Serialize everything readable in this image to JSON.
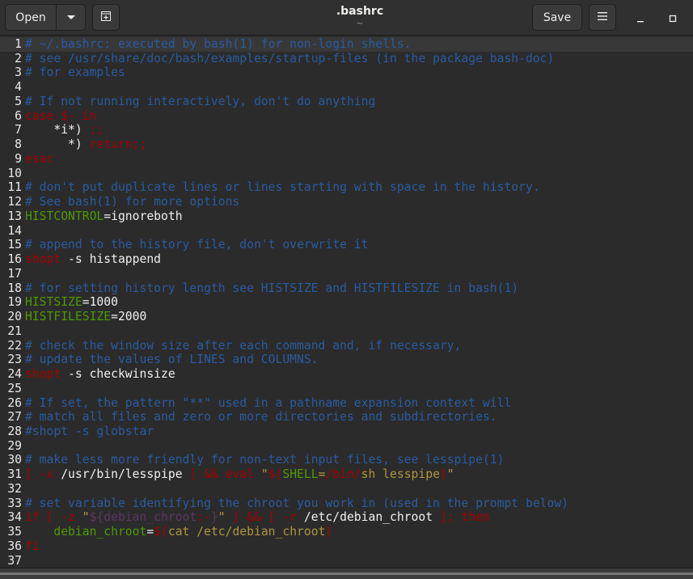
{
  "header": {
    "open_label": "Open",
    "open_menu_icon": "chevron-down-icon",
    "new_tab_icon": "new-document-icon",
    "title": ".bashrc",
    "subtitle": "~",
    "save_label": "Save",
    "menu_icon": "hamburger-icon",
    "minimize_icon": "minimize-icon",
    "maximize_icon": "maximize-icon"
  },
  "colors": {
    "comment": "#2a5ba0",
    "keyword": "#a40000",
    "variable": "#4e9a06",
    "string": "#b09540",
    "plain": "#f0f0f0"
  },
  "editor": {
    "current_line": 1,
    "lines": [
      {
        "n": "1",
        "segs": [
          [
            "comment",
            "# ~/.bashrc: executed by bash(1) for non-login shells."
          ]
        ]
      },
      {
        "n": "2",
        "segs": [
          [
            "comment",
            "# see /usr/share/doc/bash/examples/startup-files (in the package bash-doc)"
          ]
        ]
      },
      {
        "n": "3",
        "segs": [
          [
            "comment",
            "# for examples"
          ]
        ]
      },
      {
        "n": "4",
        "segs": []
      },
      {
        "n": "5",
        "segs": [
          [
            "comment",
            "# If not running interactively, don't do anything"
          ]
        ]
      },
      {
        "n": "6",
        "segs": [
          [
            "kw",
            "case"
          ],
          [
            "plain",
            " "
          ],
          [
            "kw",
            "$-"
          ],
          [
            "plain",
            " "
          ],
          [
            "kw",
            "in"
          ]
        ]
      },
      {
        "n": "7",
        "segs": [
          [
            "plain",
            "    *i*) "
          ],
          [
            "kw",
            ";;"
          ]
        ]
      },
      {
        "n": "8",
        "segs": [
          [
            "plain",
            "      *) "
          ],
          [
            "kw",
            "return;;"
          ]
        ]
      },
      {
        "n": "9",
        "segs": [
          [
            "kw",
            "esac"
          ]
        ]
      },
      {
        "n": "10",
        "segs": []
      },
      {
        "n": "11",
        "segs": [
          [
            "comment",
            "# don't put duplicate lines or lines starting with space in the history."
          ]
        ]
      },
      {
        "n": "12",
        "segs": [
          [
            "comment",
            "# See bash(1) for more options"
          ]
        ]
      },
      {
        "n": "13",
        "segs": [
          [
            "var",
            "HISTCONTROL"
          ],
          [
            "plain",
            "=ignoreboth"
          ]
        ]
      },
      {
        "n": "14",
        "segs": []
      },
      {
        "n": "15",
        "segs": [
          [
            "comment",
            "# append to the history file, don't overwrite it"
          ]
        ]
      },
      {
        "n": "16",
        "segs": [
          [
            "kw",
            "shopt"
          ],
          [
            "plain",
            " -s histappend"
          ]
        ]
      },
      {
        "n": "17",
        "segs": []
      },
      {
        "n": "18",
        "segs": [
          [
            "comment",
            "# for setting history length see HISTSIZE and HISTFILESIZE in bash(1)"
          ]
        ]
      },
      {
        "n": "19",
        "segs": [
          [
            "var",
            "HISTSIZE"
          ],
          [
            "plain",
            "=1000"
          ]
        ]
      },
      {
        "n": "20",
        "segs": [
          [
            "var",
            "HISTFILESIZE"
          ],
          [
            "plain",
            "=2000"
          ]
        ]
      },
      {
        "n": "21",
        "segs": []
      },
      {
        "n": "22",
        "segs": [
          [
            "comment",
            "# check the window size after each command and, if necessary,"
          ]
        ]
      },
      {
        "n": "23",
        "segs": [
          [
            "comment",
            "# update the values of LINES and COLUMNS."
          ]
        ]
      },
      {
        "n": "24",
        "segs": [
          [
            "kw",
            "shopt"
          ],
          [
            "plain",
            " -s checkwinsize"
          ]
        ]
      },
      {
        "n": "25",
        "segs": []
      },
      {
        "n": "26",
        "segs": [
          [
            "comment",
            "# If set, the pattern \"**\" used in a pathname expansion context will"
          ]
        ]
      },
      {
        "n": "27",
        "segs": [
          [
            "comment",
            "# match all files and zero or more directories and subdirectories."
          ]
        ]
      },
      {
        "n": "28",
        "segs": [
          [
            "comment",
            "#shopt -s globstar"
          ]
        ]
      },
      {
        "n": "29",
        "segs": []
      },
      {
        "n": "30",
        "segs": [
          [
            "comment",
            "# make less more friendly for non-text input files, see lesspipe(1)"
          ]
        ]
      },
      {
        "n": "31",
        "segs": [
          [
            "kw",
            "["
          ],
          [
            "plain",
            " "
          ],
          [
            "kw",
            "-x"
          ],
          [
            "plain",
            " /usr/bin/lesspipe "
          ],
          [
            "kw",
            "]"
          ],
          [
            "plain",
            " "
          ],
          [
            "kw",
            "&&"
          ],
          [
            "plain",
            " "
          ],
          [
            "kw",
            "eval"
          ],
          [
            "plain",
            " "
          ],
          [
            "str",
            "\""
          ],
          [
            "kw",
            "$("
          ],
          [
            "var",
            "SHELL"
          ],
          [
            "str",
            "="
          ],
          [
            "kw",
            "/bin/"
          ],
          [
            "str",
            "sh lesspipe"
          ],
          [
            "kw",
            ")"
          ],
          [
            "str",
            "\""
          ]
        ]
      },
      {
        "n": "32",
        "segs": []
      },
      {
        "n": "33",
        "segs": [
          [
            "comment",
            "# set variable identifying the chroot you work in (used in the prompt below)"
          ]
        ]
      },
      {
        "n": "34",
        "segs": [
          [
            "kw",
            "if"
          ],
          [
            "plain",
            " "
          ],
          [
            "kw",
            "["
          ],
          [
            "plain",
            " "
          ],
          [
            "kw",
            "-z"
          ],
          [
            "plain",
            " "
          ],
          [
            "str",
            "\""
          ],
          [
            "sub",
            "${debian_chroot"
          ],
          [
            "kw",
            ":-"
          ],
          [
            "sub",
            "}"
          ],
          [
            "str",
            "\""
          ],
          [
            "plain",
            " "
          ],
          [
            "kw",
            "]"
          ],
          [
            "plain",
            " "
          ],
          [
            "kw",
            "&&"
          ],
          [
            "plain",
            " "
          ],
          [
            "kw",
            "["
          ],
          [
            "plain",
            " "
          ],
          [
            "kw",
            "-r"
          ],
          [
            "plain",
            " /etc/debian_chroot "
          ],
          [
            "kw",
            "];"
          ],
          [
            "plain",
            " "
          ],
          [
            "kw",
            "then"
          ]
        ]
      },
      {
        "n": "35",
        "segs": [
          [
            "plain",
            "    "
          ],
          [
            "var",
            "debian_chroot"
          ],
          [
            "plain",
            "="
          ],
          [
            "kw",
            "$("
          ],
          [
            "str",
            "cat /etc/debian_chroot"
          ],
          [
            "kw",
            ")"
          ]
        ]
      },
      {
        "n": "36",
        "segs": [
          [
            "kw",
            "fi"
          ]
        ]
      },
      {
        "n": "37",
        "segs": []
      }
    ]
  }
}
